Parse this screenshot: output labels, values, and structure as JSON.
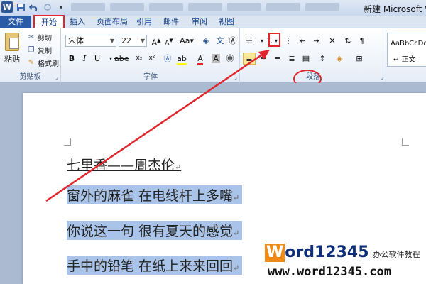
{
  "window": {
    "title": "新建 Microsoft Wo",
    "app_icon": "word-app-icon"
  },
  "tabs": {
    "file": "文件",
    "home": "开始",
    "insert": "插入",
    "layout": "页面布局",
    "references": "引用",
    "mailings": "邮件",
    "review": "审阅",
    "view": "视图"
  },
  "clipboard": {
    "paste": "粘贴",
    "cut": "剪切",
    "copy": "复制",
    "format_painter": "格式刷",
    "label": "剪贴板"
  },
  "font": {
    "name": "宋体",
    "size": "22",
    "label": "字体"
  },
  "paragraph": {
    "label": "段落"
  },
  "styles": {
    "sample": "AaBbCcDd",
    "normal": "↵ 正文"
  },
  "document": {
    "heading": "七里香——周杰伦",
    "lines": [
      "窗外的麻雀  在电线杆上多嘴",
      "你说这一句  很有夏天的感觉",
      "手中的铅笔  在纸上来来回回"
    ],
    "para_mark": "↵"
  },
  "watermark": {
    "brand_w": "W",
    "brand_rest": "ord12345",
    "tagline": "办公软件教程",
    "url": "www.word12345.com"
  },
  "colors": {
    "highlight": "#a9c4e8",
    "annotation_red": "#e0262c",
    "file_tab": "#2a5ba8"
  }
}
